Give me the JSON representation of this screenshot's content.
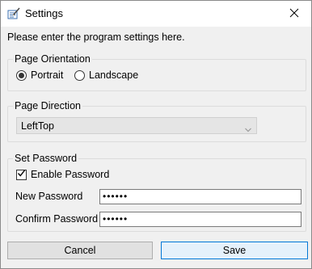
{
  "window": {
    "title": "Settings"
  },
  "intro_text": "Please enter the program settings here.",
  "orientation": {
    "title": "Page Orientation",
    "options": [
      {
        "label": "Portrait",
        "selected": true
      },
      {
        "label": "Landscape",
        "selected": false
      }
    ]
  },
  "direction": {
    "title": "Page Direction",
    "selected_value": "LeftTop",
    "enabled": false
  },
  "password": {
    "title": "Set Password",
    "enable_label": "Enable Password",
    "enabled": true,
    "new_label": "New Password",
    "new_value": "••••••",
    "confirm_label": "Confirm Password",
    "confirm_value": "••••••"
  },
  "buttons": {
    "cancel": "Cancel",
    "save": "Save"
  },
  "colors": {
    "accent": "#0078d7",
    "window_bg": "#f0f0f0",
    "titlebar_bg": "#ffffff"
  },
  "icons": {
    "app": "settings-app-icon",
    "close": "close-icon",
    "dropdown": "chevron-down-icon",
    "check": "check-icon"
  }
}
